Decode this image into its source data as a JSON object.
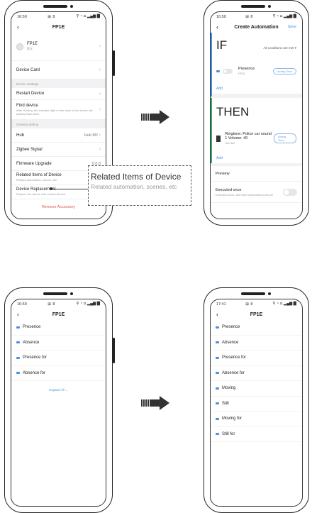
{
  "status": {
    "time_a": "16:50",
    "time_b": "17:41",
    "icons_mid": "⊞ 8",
    "icons_right": "⚲ ◔ ⩍ ▂▄▆ ▇"
  },
  "screen1": {
    "title": "FP1E",
    "device_name": "FP1E",
    "device_room": "默认",
    "device_card": "Device Card",
    "section_settings": "Device Settings",
    "restart": "Restart Device",
    "find_device": "Find device",
    "find_device_sub": "After clicking, the indicator light on the back of the device will quickly flash twice.",
    "section_general": "General Setting",
    "hub_label": "Hub",
    "hub_value": "Hub M2",
    "zigbee": "Zigbee Signal",
    "firmware": "Firmware Upgrade",
    "firmware_value": "0.0.0",
    "related": "Related Items of Device",
    "related_sub": "Related automation, scenes, etc",
    "replacement": "Device Replacement",
    "replacement_sub": "Replace the device with another device",
    "remove": "Remove Accessory"
  },
  "callout": {
    "title": "Related Items of Device",
    "subtitle": "Related automation, scenes, etc"
  },
  "screen2": {
    "title": "Create Automation",
    "save": "Save",
    "if_label": "IF",
    "conditions": "All conditions are met ▾",
    "trigger_name": "Presence",
    "trigger_sub": "FP1E",
    "acting_time": "Acting Time",
    "add": "Add",
    "then_label": "THEN",
    "action_name": "Ringtone: Police car sound 1 Volume: 40",
    "action_sub": "Hub M2",
    "preview": "Preview",
    "executed_once": "Executed once",
    "executed_once_sub": "Executed once, and then automation turns off"
  },
  "screen3": {
    "title": "FP1E",
    "items": [
      "Presence",
      "Absence",
      "Presence for",
      "Absence for"
    ],
    "expand_all": "Expand All ⌄"
  },
  "screen4": {
    "title": "FP1E",
    "items": [
      "Presence",
      "Absence",
      "Presence for",
      "Absence for",
      "Moving",
      "Still",
      "Moving for",
      "Still for"
    ]
  },
  "colors": {
    "accent": "#4a90e2",
    "danger": "#e0544b",
    "then_band": "#3aa76d"
  }
}
